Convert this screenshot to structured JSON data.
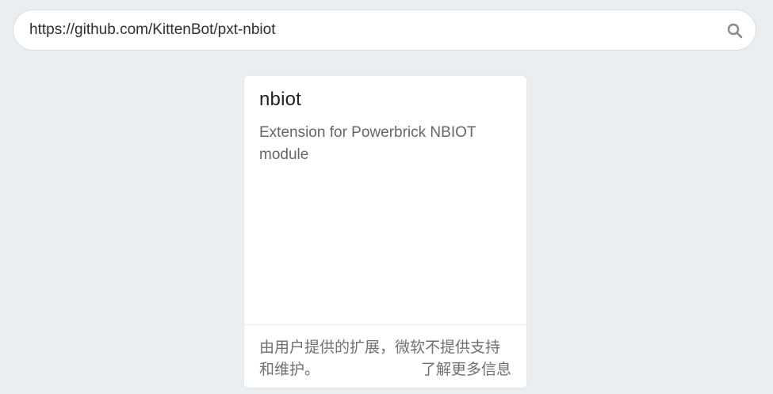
{
  "search": {
    "value": "https://github.com/KittenBot/pxt-nbiot"
  },
  "card": {
    "title": "nbiot",
    "description": "Extension for Powerbrick NBIOT module",
    "footer_note": "由用户提供的扩展，微软不提供支持和维护。",
    "learn_more_label": "了解更多信息"
  },
  "colors": {
    "page_background": "#ebeef0",
    "card_background": "#ffffff"
  }
}
